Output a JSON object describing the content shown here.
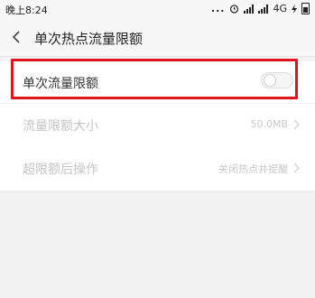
{
  "status": {
    "time": "晚上8:24",
    "dots": "...",
    "network": "4G"
  },
  "header": {
    "title": "单次热点流量限额"
  },
  "rows": [
    {
      "label": "单次流量限额",
      "toggle_on": false
    },
    {
      "label": "流量限额大小",
      "value": "50.0MB",
      "enabled": false
    },
    {
      "label": "超限额后操作",
      "value": "关闭热点并提醒",
      "enabled": false
    }
  ],
  "colors": {
    "highlight": "#e0141e",
    "disabled_text": "#c4c4c4"
  }
}
